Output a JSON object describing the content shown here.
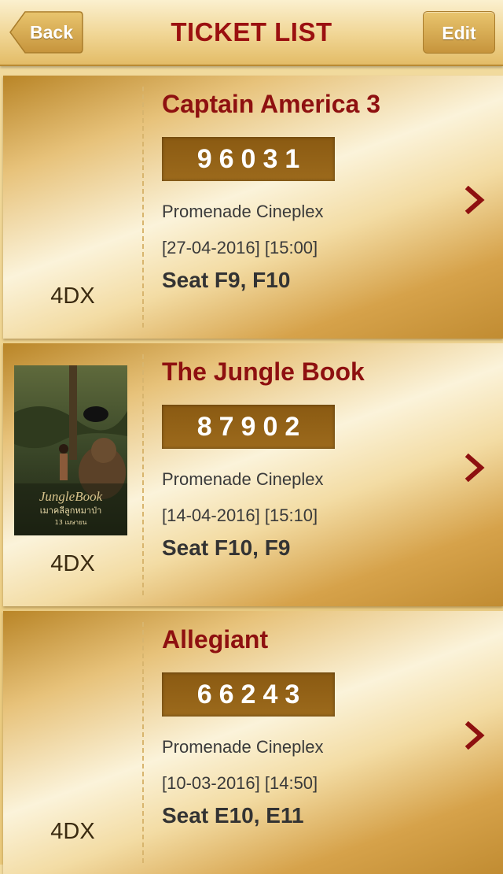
{
  "navbar": {
    "back_label": "Back",
    "title": "TICKET LIST",
    "edit_label": "Edit"
  },
  "tickets": [
    {
      "movie": "Captain America 3",
      "code": "96031",
      "cinema": "Promenade Cineplex",
      "datetime": "[27-04-2016] [15:00]",
      "seat": "Seat F9, F10",
      "format": "4DX",
      "has_poster": false
    },
    {
      "movie": "The Jungle Book",
      "code": "87902",
      "cinema": "Promenade Cineplex",
      "datetime": "[14-04-2016] [15:10]",
      "seat": "Seat F10, F9",
      "format": "4DX",
      "has_poster": true,
      "poster_lettering": "THE JUNGLE BOOK เมาคลีลูกหมาป่า 13 เมษายน"
    },
    {
      "movie": "Allegiant",
      "code": "66243",
      "cinema": "Promenade Cineplex",
      "datetime": "[10-03-2016] [14:50]",
      "seat": "Seat E10, E11",
      "format": "4DX",
      "has_poster": false
    }
  ],
  "colors": {
    "accent": "#9b1010",
    "gold": "#e3bc67",
    "code_box": "#8a5a12"
  },
  "icons": {
    "back": "back-arrow-icon",
    "row_chevron": "chevron-right-icon"
  }
}
